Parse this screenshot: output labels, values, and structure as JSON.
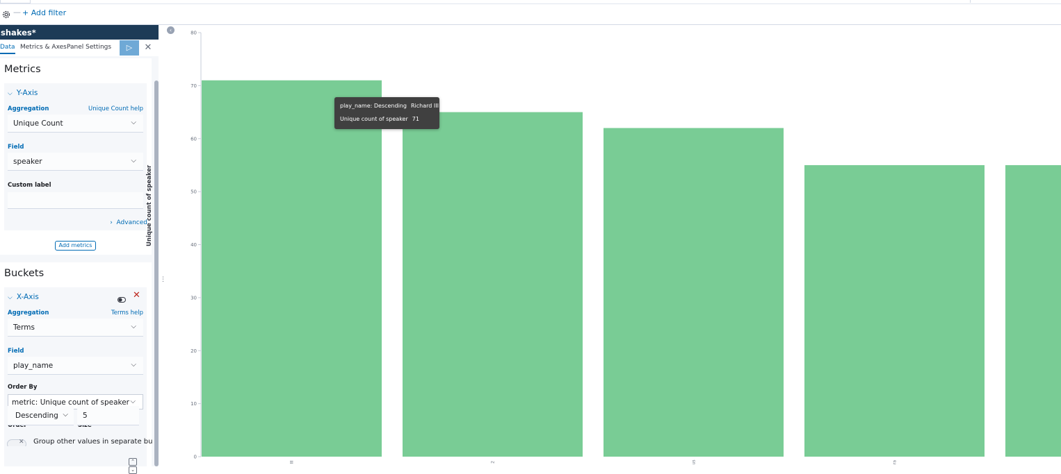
{
  "filter_bar": {
    "dash": "—",
    "add_filter": "+ Add filter",
    "settings_icon": "gear-icon"
  },
  "sidebar": {
    "index_pattern": "shakes*",
    "tabs": [
      {
        "label": "Data",
        "active": true
      },
      {
        "label": "Metrics & Axes",
        "active": false
      },
      {
        "label": "Panel Settings",
        "active": false
      }
    ],
    "apply_icon": "play-icon",
    "discard_icon": "close-icon",
    "metrics": {
      "title": "Metrics",
      "y_axis": {
        "header": "Y-Axis",
        "aggregation_label": "Aggregation",
        "aggregation_help": "Unique Count help",
        "aggregation_value": "Unique Count",
        "field_label": "Field",
        "field_value": "speaker",
        "custom_label_label": "Custom label",
        "custom_label_value": "",
        "advanced": "Advanced"
      },
      "add_button": "Add metrics"
    },
    "buckets": {
      "title": "Buckets",
      "x_axis": {
        "header": "X-Axis",
        "aggregation_label": "Aggregation",
        "aggregation_help": "Terms help",
        "aggregation_value": "Terms",
        "field_label": "Field",
        "field_value": "play_name",
        "order_by_label": "Order By",
        "order_by_value": "metric: Unique count of speaker",
        "order_label": "Order",
        "order_value": "Descending",
        "size_label": "Size",
        "size_value": "5",
        "group_other_label": "Group other values in separate bucket"
      }
    }
  },
  "tooltip": {
    "rows": [
      {
        "key": "play_name: Descending",
        "value": "Richard III"
      },
      {
        "key": "Unique count of speaker",
        "value": "71"
      }
    ]
  },
  "chart_data": {
    "type": "bar",
    "ylabel": "Unique count of speaker",
    "xlabel": "",
    "ylim": [
      0,
      80
    ],
    "yticks": [
      0,
      10,
      20,
      30,
      40,
      50,
      60,
      70,
      80
    ],
    "categories": [
      "III",
      "2",
      "us",
      "ra",
      ""
    ],
    "values": [
      71,
      65,
      62,
      55,
      55
    ],
    "bar_color": "#79cc95",
    "grid": false,
    "legend": "none"
  }
}
